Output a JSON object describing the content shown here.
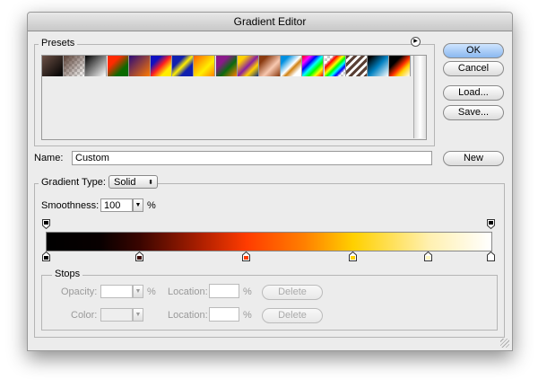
{
  "window": {
    "title": "Gradient Editor"
  },
  "presets": {
    "label": "Presets",
    "menu_icon": "circle-arrow-icon",
    "swatches": [
      "linear-gradient(135deg,#6b5045,#000)",
      "linear-gradient(135deg,#5a4035,rgba(255,255,255,0)),repeating-conic-gradient(#ccc 0 25%,#fff 0 50%) 0 0/6px 6px",
      "linear-gradient(135deg,#000,#fff)",
      "linear-gradient(135deg,#ff2a00 30%,#0a6a00 70%)",
      "linear-gradient(135deg,#2a0a7a,#ff7a00)",
      "linear-gradient(135deg,#1010c0 25%,#ff2020 50%,#ffee00 75%)",
      "linear-gradient(135deg,#1020b0 30%,#ffee00 50%,#1020b0 70%)",
      "linear-gradient(135deg,#ff6000,#ffee00 60%,#ff8000)",
      "linear-gradient(135deg,#8a1a8a 30%,#0a6a10 60%,#ff8000)",
      "linear-gradient(135deg,#ffd000 20%,#8a20a0 50%,#ffd000 70%,#103080)",
      "linear-gradient(135deg,#8a3a10 20%,#f8c8b0 60%,#8a3a10)",
      "linear-gradient(135deg,#0090e0 20%,#ffffff 50%,#d08010 60%,#fff 80%)",
      "linear-gradient(135deg,#ff0000,#ff00ff 20%,#0000ff 35%,#00ffff 50%,#00ff00 65%,#ffff00 80%,#ff0000)",
      "linear-gradient(135deg,rgba(255,0,0,0) 20%,#ff0000 30%,#ffff00 45%,#00ff00 55%,#00ffff 65%,#0000ff 75%,rgba(255,0,255,0) 85%),repeating-conic-gradient(#ccc 0 25%,#fff 0 50%) 0 0/6px 6px",
      "repeating-linear-gradient(135deg,#5a4035 0 3px,#fff 3px 6px)",
      "linear-gradient(135deg,#000 10%,#0080c0 50%,#fff)",
      "linear-gradient(135deg,#000 30%,#ff3000 55%,#ffd000 70%,#fff)"
    ]
  },
  "buttons": {
    "ok": "OK",
    "cancel": "Cancel",
    "load": "Load...",
    "save": "Save...",
    "new": "New"
  },
  "name": {
    "label": "Name:",
    "value": "Custom"
  },
  "gradient_type": {
    "label": "Gradient Type:",
    "value": "Solid"
  },
  "smoothness": {
    "label": "Smoothness:",
    "value": "100",
    "unit": "%"
  },
  "opacity_stops": [
    {
      "location": 0,
      "color": "#000000"
    },
    {
      "location": 100,
      "color": "#000000"
    }
  ],
  "color_stops": [
    {
      "location": 0,
      "color": "#000000"
    },
    {
      "location": 21,
      "color": "#3a0500"
    },
    {
      "location": 45,
      "color": "#ff3c00"
    },
    {
      "location": 69,
      "color": "#ffd000"
    },
    {
      "location": 86,
      "color": "#fff8c0"
    },
    {
      "location": 100,
      "color": "#ffffff"
    }
  ],
  "stops": {
    "label": "Stops",
    "opacity_label": "Opacity:",
    "color_label": "Color:",
    "location_label": "Location:",
    "percent": "%",
    "delete": "Delete"
  }
}
